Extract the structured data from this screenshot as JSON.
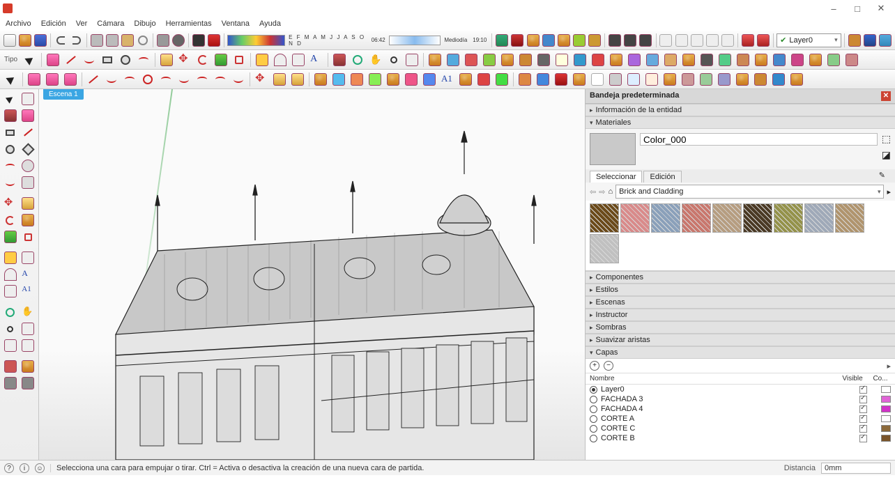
{
  "window": {
    "minimize": "–",
    "maximize": "□",
    "close": "✕"
  },
  "menu": [
    "Archivo",
    "Edición",
    "Ver",
    "Cámara",
    "Dibujo",
    "Herramientas",
    "Ventana",
    "Ayuda"
  ],
  "toolbar1": {
    "tipo_label": "Tipo",
    "time_left": "06:42",
    "time_mid": "Mediodía",
    "time_right": "19:10",
    "months": "E F M A M J J A S O N D",
    "layer_label": "Layer0"
  },
  "scene_tab": "Escena 1",
  "tray": {
    "title": "Bandeja predeterminada",
    "sections": {
      "entity_info": "Información de la entidad",
      "materials": "Materiales",
      "components": "Componentes",
      "styles": "Estilos",
      "scenes": "Escenas",
      "instructor": "Instructor",
      "shadows": "Sombras",
      "soften": "Suavizar aristas",
      "layers": "Capas"
    },
    "material_name": "Color_000",
    "mat_tab_select": "Seleccionar",
    "mat_tab_edit": "Edición",
    "mat_category": "Brick and Cladding",
    "mat_swatches": [
      "#6b4a1a",
      "#d98a8a",
      "#8aa0ba",
      "#c9776d",
      "#b69d80",
      "#4a3924",
      "#94924a",
      "#9fa9b8",
      "#b0946d",
      "#c0c0c0"
    ],
    "layers_cols": {
      "name": "Nombre",
      "visible": "Visible",
      "color": "Co..."
    },
    "layers": [
      {
        "name": "Layer0",
        "selected": true,
        "color": "#ffffff"
      },
      {
        "name": "FACHADA 3",
        "selected": false,
        "color": "#e064d6"
      },
      {
        "name": "FACHADA 4",
        "selected": false,
        "color": "#d132c8"
      },
      {
        "name": "CORTE A",
        "selected": false,
        "color": "#ffffff"
      },
      {
        "name": "CORTE C",
        "selected": false,
        "color": "#8c6a3b"
      },
      {
        "name": "CORTE B",
        "selected": false,
        "color": "#7a542a"
      }
    ]
  },
  "status": {
    "tip": "Selecciona una cara para empujar o tirar. Ctrl = Activa o desactiva la creación de una nueva cara de partida.",
    "distance_label": "Distancia",
    "distance_value": "0mm"
  }
}
